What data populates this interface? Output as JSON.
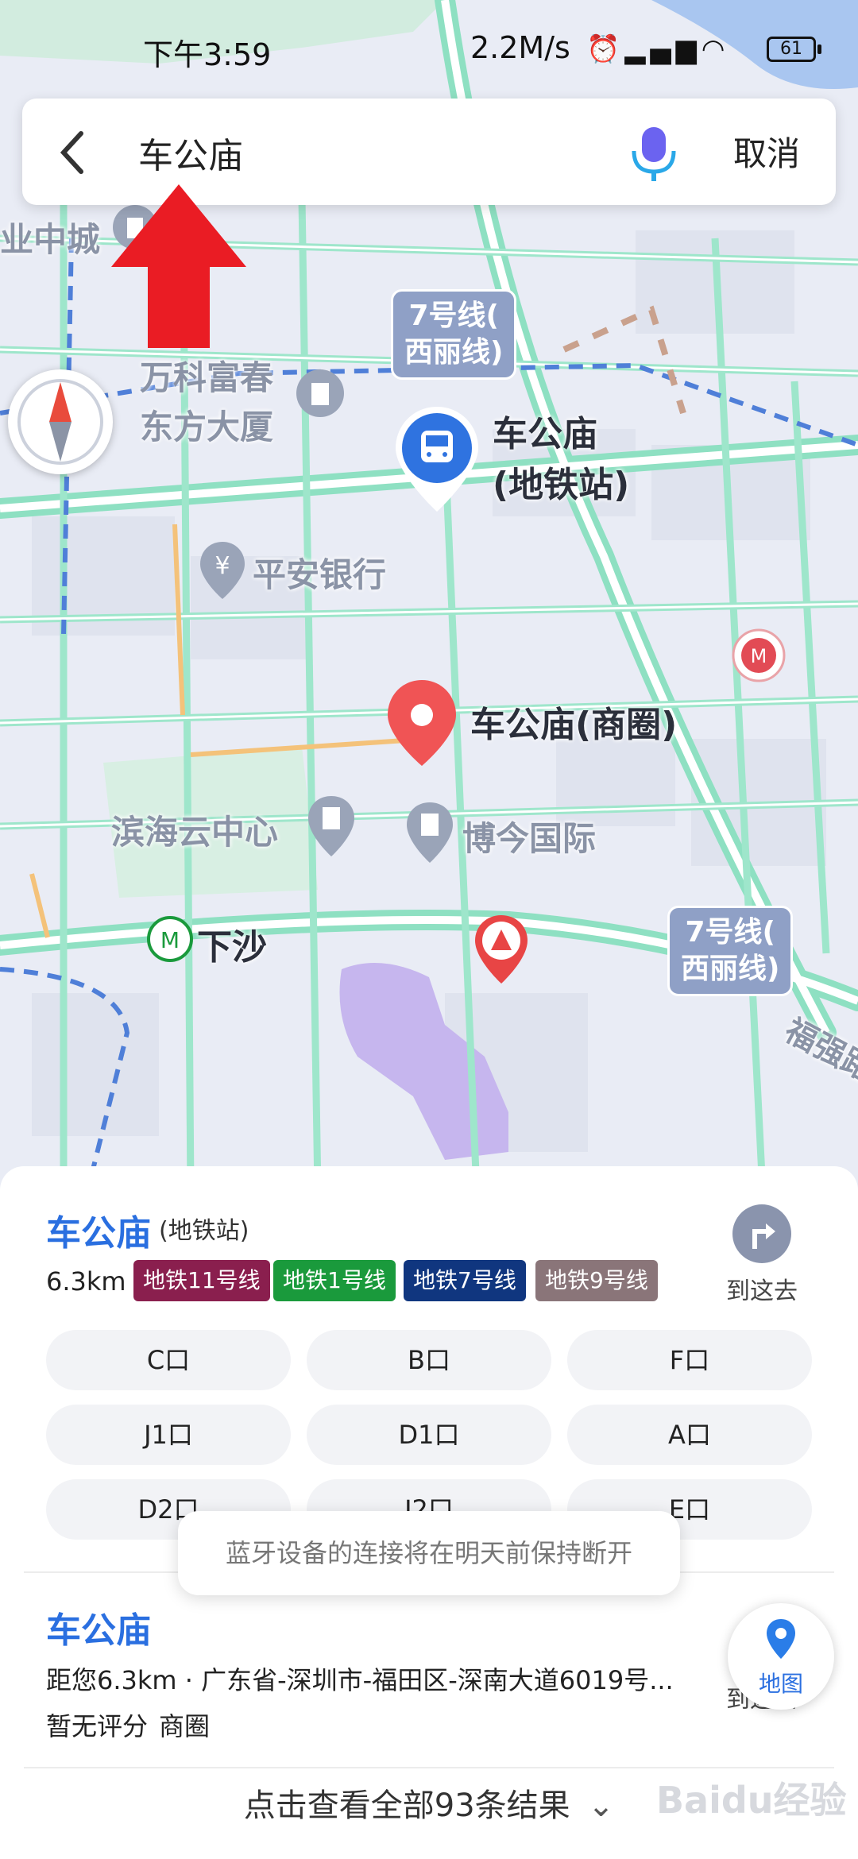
{
  "status_bar": {
    "time": "下午3:59",
    "network_speed": "2.2M/s",
    "battery": "61"
  },
  "search": {
    "query": "车公庙",
    "cancel_label": "取消"
  },
  "map": {
    "labels": {
      "mall": "业中城",
      "vanke_1": "万科富春",
      "vanke_2": "东方大厦",
      "station_1": "车公庙",
      "station_2": "(地铁站)",
      "bank": "平安银行",
      "selected": "车公庙(商圈)",
      "binhai": "滨海云中心",
      "bojin": "博今国际",
      "xiasha": "下沙",
      "road": "福强路"
    },
    "line_badges": [
      {
        "line1": "7号线(",
        "line2": "西丽线)"
      },
      {
        "line1": "7号线(",
        "line2": "西丽线)"
      }
    ]
  },
  "result1": {
    "title": "车公庙",
    "subtitle": "(地铁站)",
    "distance": "6.3km",
    "tags": [
      {
        "label": "地铁11号线",
        "color": "#8a1f4e"
      },
      {
        "label": "地铁1号线",
        "color": "#1a9a3c"
      },
      {
        "label": "地铁7号线",
        "color": "#10367f"
      },
      {
        "label": "地铁9号线",
        "color": "#8a7579"
      }
    ],
    "route_label": "到这去",
    "exits": [
      "C口",
      "B口",
      "F口",
      "J1口",
      "D1口",
      "A口",
      "D2口",
      "J2口",
      "E口"
    ]
  },
  "result2": {
    "title": "车公庙",
    "address": "距您6.3km · 广东省-深圳市-福田区-深南大道6019号...",
    "rating": "暂无评分",
    "category": "商圈",
    "route_label": "到这去"
  },
  "map_button_label": "地图",
  "toast": "蓝牙设备的连接将在明天前保持断开",
  "more_results": "点击查看全部93条结果",
  "watermark": "Baidu经验",
  "icons": {
    "back": "back-arrow-icon",
    "mic": "microphone-icon",
    "compass": "compass-icon",
    "route": "route-turn-icon",
    "map": "map-pin-icon",
    "chevron": "chevron-down-icon"
  }
}
